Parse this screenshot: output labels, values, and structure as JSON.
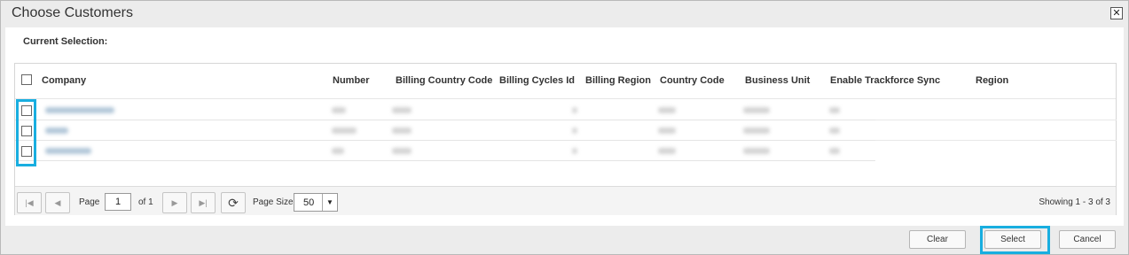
{
  "dialog": {
    "title": "Choose Customers",
    "close_icon": "close-icon",
    "close_glyph": "✕"
  },
  "current_selection_label": "Current Selection:",
  "grid": {
    "columns": [
      "Company",
      "Number",
      "Billing Country Code",
      "Billing Cycles Id",
      "Billing Region",
      "Country Code",
      "Business Unit",
      "Enable Trackforce Sync",
      "Region"
    ],
    "row_count": 3
  },
  "pager": {
    "page_label": "Page",
    "page_value": "1",
    "of_label": "of 1",
    "page_size_label": "Page Size",
    "page_size_value": "50",
    "showing": "Showing 1 - 3 of 3",
    "icons": {
      "first": "first-page-icon",
      "prev": "prev-page-icon",
      "next": "next-page-icon",
      "last": "last-page-icon",
      "refresh": "refresh-icon",
      "dropdown": "chevron-down-icon"
    }
  },
  "footer": {
    "clear_label": "Clear",
    "select_label": "Select",
    "cancel_label": "Cancel"
  },
  "colors": {
    "highlight": "#19aee0",
    "link_blur": "#9fb9cf"
  }
}
